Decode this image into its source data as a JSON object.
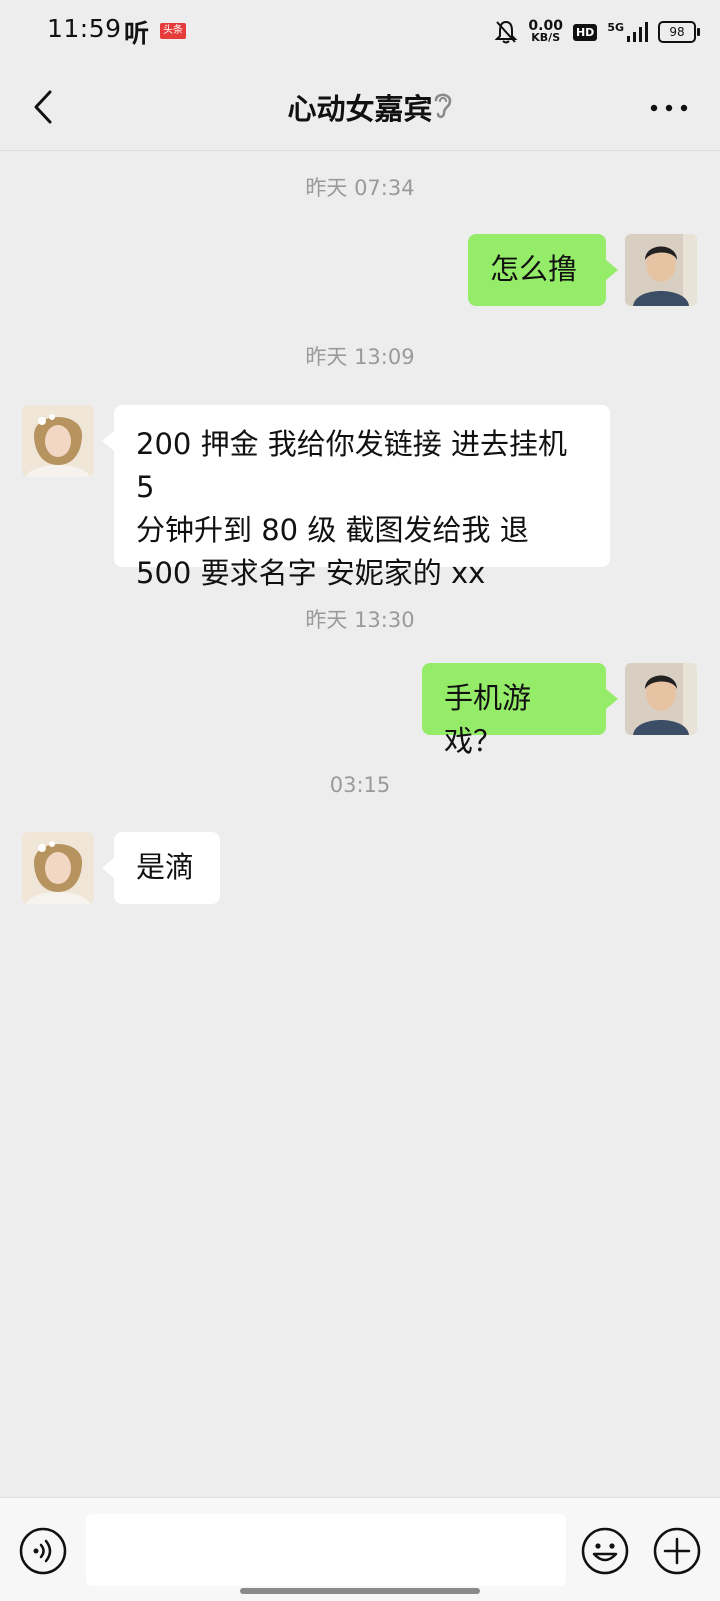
{
  "status_bar": {
    "time": "11:59",
    "ting_icon_text": "听",
    "toutiao_badge": "头条",
    "net_speed_value": "0.00",
    "net_speed_unit": "KB/S",
    "hd_label": "HD",
    "network_type": "5G",
    "battery": "98"
  },
  "header": {
    "title": "心动女嘉宾"
  },
  "messages": [
    {
      "timestamp": "昨天 07:34",
      "direction": "out",
      "text": "怎么撸"
    },
    {
      "timestamp": "昨天 13:09",
      "direction": "in",
      "lines": [
        "200 押金 我给你发链接 进去挂机 5",
        "分钟升到 80 级  截图发给我 退",
        "500  要求名字 安妮家的 xx"
      ]
    },
    {
      "timestamp": "昨天 13:30",
      "direction": "out",
      "text": "手机游戏？"
    },
    {
      "timestamp": "03:15",
      "direction": "in",
      "text": "是滴"
    }
  ],
  "colors": {
    "background": "#ededed",
    "outgoing_bubble": "#95ec69",
    "incoming_bubble": "#ffffff"
  },
  "icons": {
    "back": "chevron-left-icon",
    "ear": "ear-icon",
    "more": "more-dots-icon",
    "voice": "voice-icon",
    "emoji": "emoji-icon",
    "plus": "plus-icon"
  }
}
